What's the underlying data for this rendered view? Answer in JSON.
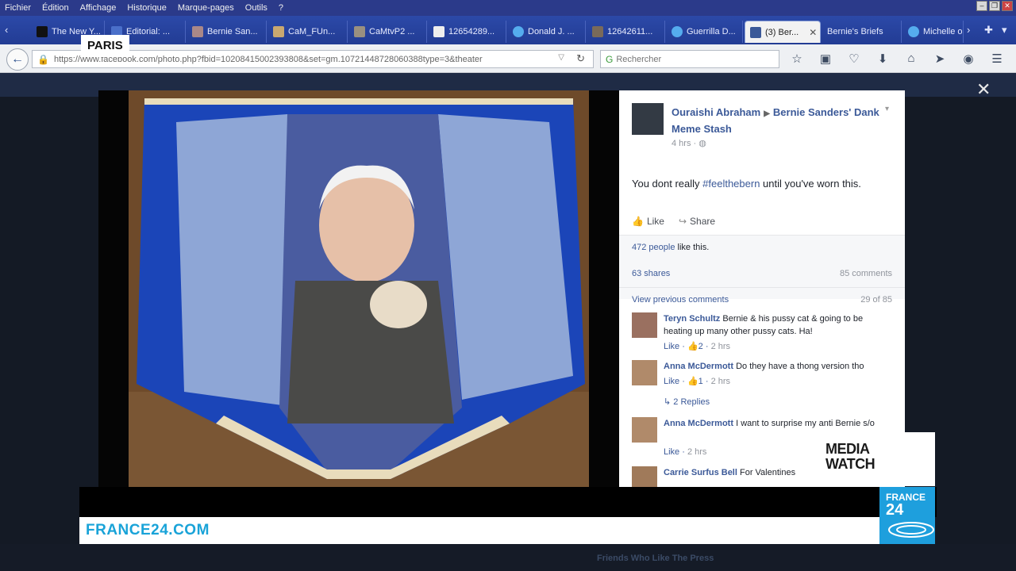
{
  "menubar": {
    "items": [
      "Fichier",
      "Édition",
      "Affichage",
      "Historique",
      "Marque-pages",
      "Outils",
      "?"
    ]
  },
  "tabs": [
    {
      "label": "The New Y...",
      "icon": "nyt-icon"
    },
    {
      "label": "Editorial: ...",
      "icon": "b-icon"
    },
    {
      "label": "Bernie San...",
      "icon": "image-icon"
    },
    {
      "label": "CaM_FUn...",
      "icon": "image-icon"
    },
    {
      "label": "CaMtvP2 ...",
      "icon": "image-icon"
    },
    {
      "label": "12654289...",
      "icon": "page-icon"
    },
    {
      "label": "Donald J. ...",
      "icon": "twitter-icon"
    },
    {
      "label": "12642611...",
      "icon": "image-icon"
    },
    {
      "label": "Guerrilla D...",
      "icon": "twitter-icon"
    },
    {
      "label": "(3) Ber...",
      "icon": "facebook-icon",
      "active": true
    },
    {
      "label": "Bernie's Briefs",
      "icon": "none"
    },
    {
      "label": "Michelle o",
      "icon": "twitter-icon"
    }
  ],
  "navbar": {
    "url": "https://www.facebook.com/photo.php?fbid=10208415002393808&set=gm.10721448728060388type=3&theater",
    "search_placeholder": "Rechercher"
  },
  "overlay": {
    "location": "PARIS",
    "show_line1": "MEDIA",
    "show_line2": "WATCH",
    "site": "FRANCE24.COM",
    "logo_line1": "FRANCE",
    "logo_line2": "24"
  },
  "post": {
    "author": "Ouraishi Abraham",
    "group": "Bernie Sanders' Dank Meme Stash",
    "time": "4 hrs",
    "text_before": "You dont really ",
    "hashtag": "#feelthebern",
    "text_after": " until you've worn this.",
    "like_label": "Like",
    "share_label": "Share",
    "likes_count": "472 people",
    "likes_suffix": " like this.",
    "shares": "63 shares",
    "comments_count": "85 comments",
    "prev_comments": "View previous comments",
    "comment_position": "29 of 85"
  },
  "comments": [
    {
      "name": "Teryn Schultz",
      "text": "Bernie & his pussy cat & going to be heating up many other pussy cats. Ha!",
      "like": "Like",
      "likes": "2",
      "time": "2 hrs"
    },
    {
      "name": "Anna McDermott",
      "text": "Do they have a thong version tho",
      "like": "Like",
      "likes": "1",
      "time": "2 hrs"
    },
    {
      "name": "Anna McDermott",
      "text": "I want to surprise my anti Bernie s/o",
      "like": "Like",
      "likes": "",
      "time": "2 hrs"
    },
    {
      "name": "Carrie Surfus Bell",
      "text": "For Valentines",
      "like": "",
      "likes": "",
      "time": ""
    }
  ],
  "replies_label": "2 Replies",
  "bottom_text": "Friends Who Like The Press"
}
